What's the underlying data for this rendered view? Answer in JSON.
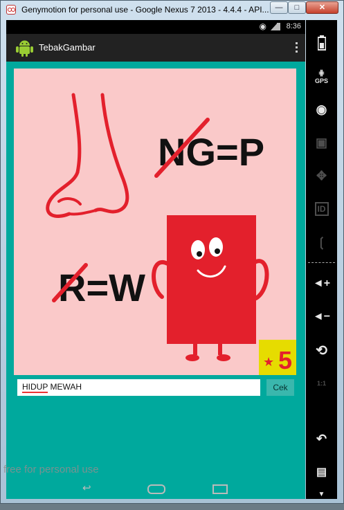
{
  "window": {
    "title": "Genymotion for personal use - Google Nexus 7 2013 - 4.4.4 - API..."
  },
  "status_bar": {
    "time": "8:36"
  },
  "action_bar": {
    "app_title": "TebakGambar"
  },
  "puzzle": {
    "clue1": "NG=P",
    "clue2": "R=W",
    "score": "5",
    "colors": {
      "background": "#fac9c9",
      "accent": "#e3202c",
      "badge": "#e6dc00"
    }
  },
  "answer": {
    "word1": "HIDUP",
    "word2": "MEWAH",
    "check_label": "Cek"
  },
  "watermark": "free for personal use",
  "side_panel": {
    "gps_label": "GPS",
    "id_label": "ID",
    "pixel_label": "1:1"
  },
  "colors": {
    "teal": "#00a99d",
    "action_bar": "#222222"
  }
}
